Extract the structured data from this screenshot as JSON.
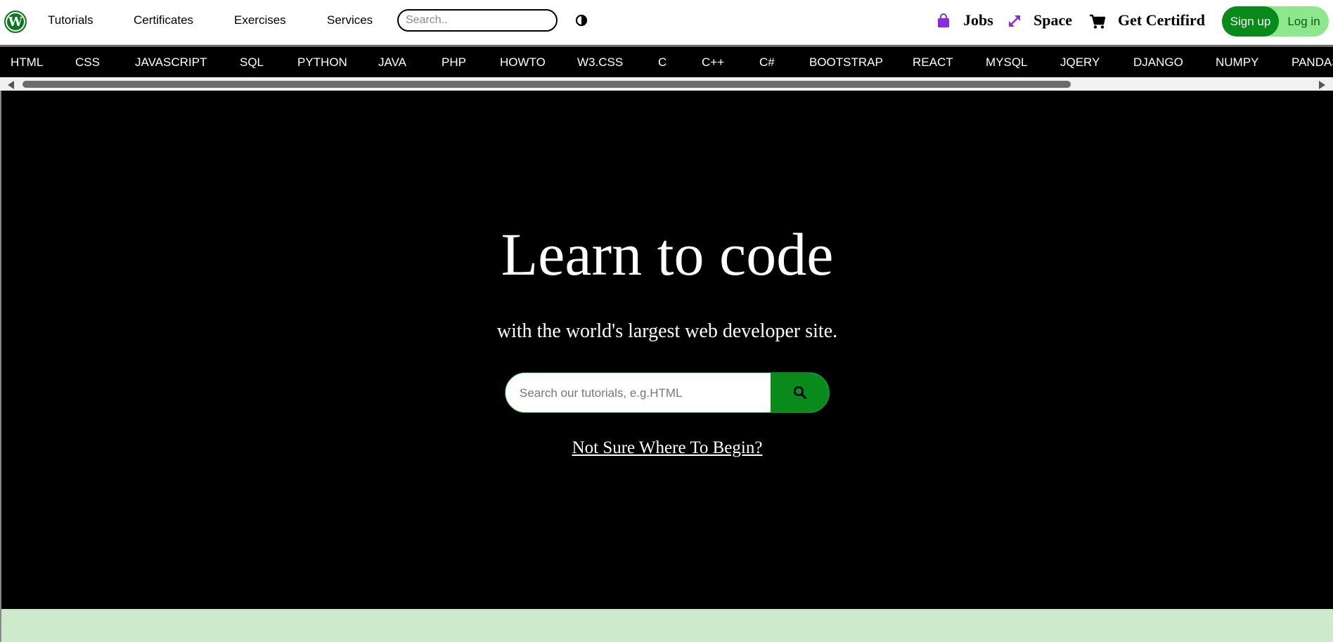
{
  "nav": {
    "logo_glyph": "W",
    "links": [
      "Tutorials",
      "Certificates",
      "Exercises",
      "Services"
    ],
    "search_placeholder": "Search..",
    "jobs": "Jobs",
    "space": "Space",
    "certified": "Get Certifird",
    "signup": "Sign up",
    "login": "Log in"
  },
  "languages": [
    "HTML",
    "CSS",
    "JAVASCRIPT",
    "SQL",
    "PYTHON",
    "JAVA",
    "PHP",
    "HOWTO",
    "W3.CSS",
    "C",
    "C++",
    "C#",
    "BOOTSTRAP",
    "REACT",
    "MYSQL",
    "JQERY",
    "DJANGO",
    "NUMPY",
    "PANDAS"
  ],
  "hero": {
    "title": "Learn to code",
    "subtitle": "with the world's largest web developer site.",
    "search_placeholder": "Search our tutorials, e.g.HTML",
    "link": "Not Sure Where To Begin?"
  },
  "colors": {
    "accent_green": "#098b1b",
    "light_green": "#8de88d",
    "band_green": "#cdebcb",
    "icon_purple": "#8a2be2"
  },
  "icons": [
    "wordpress-logo-icon",
    "search-icon",
    "contrast-icon",
    "shopping-bag-icon",
    "resize-arrows-icon",
    "cart-icon"
  ]
}
